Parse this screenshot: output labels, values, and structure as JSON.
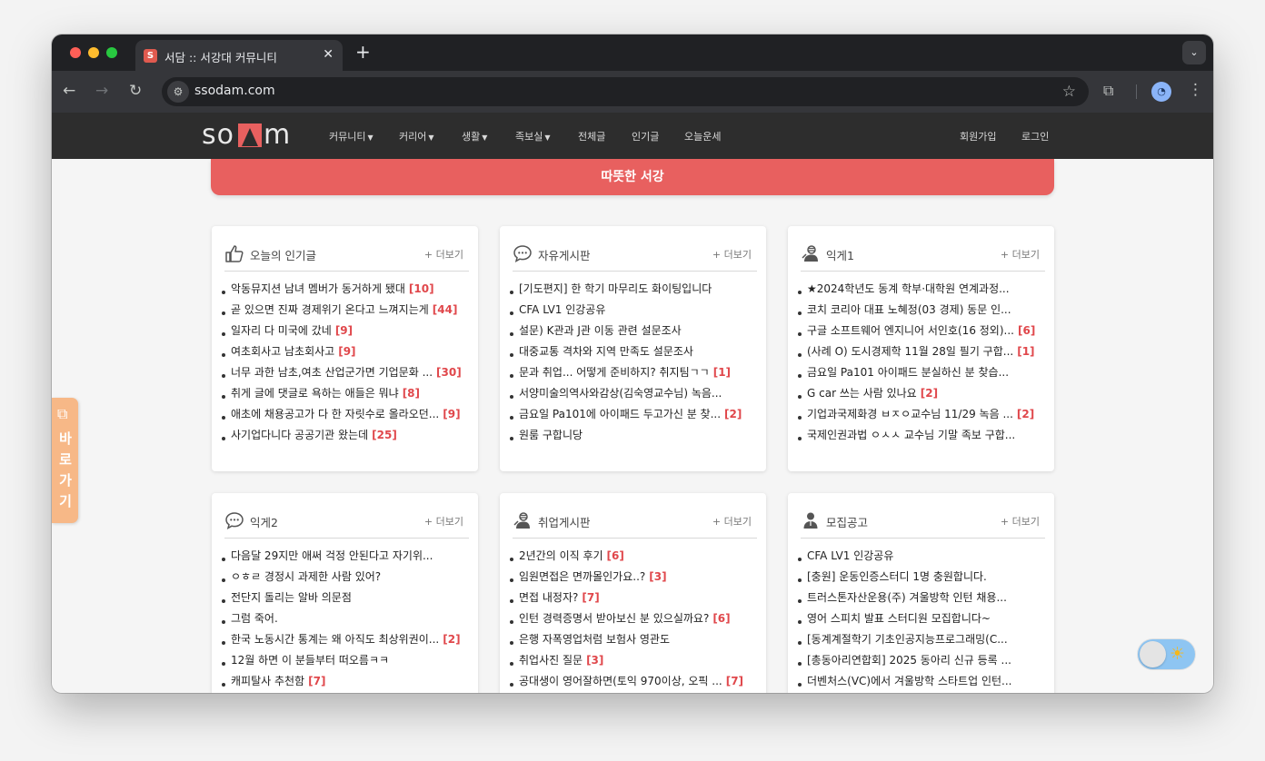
{
  "browser": {
    "tab_title": "서담 :: 서강대 커뮤니티",
    "favicon_letter": "S",
    "url": "ssodam.com"
  },
  "site": {
    "logo_text": "sodam",
    "menu": [
      {
        "label": "커뮤니티",
        "dropdown": true
      },
      {
        "label": "커리어",
        "dropdown": true
      },
      {
        "label": "생활",
        "dropdown": true
      },
      {
        "label": "족보실",
        "dropdown": true
      },
      {
        "label": "전체글",
        "dropdown": false
      },
      {
        "label": "인기글",
        "dropdown": false
      },
      {
        "label": "오늘운세",
        "dropdown": false
      }
    ],
    "signup": "회원가입",
    "login": "로그인"
  },
  "banner": "따뜻한 서강",
  "more_label": "+ 더보기",
  "sidetab_label": "바로가기",
  "colors": {
    "accent": "#e8605f",
    "count": "#e0474b",
    "header_bg": "#2d2d2d",
    "sidetab": "#f7b887",
    "toggle": "#8ec5f2"
  },
  "boards": [
    {
      "title": "오늘의 인기글",
      "icon": "thumbs-up-icon",
      "posts": [
        {
          "title": "악동뮤지션 남녀 멤버가 동거하게 됐대",
          "count": "[10]"
        },
        {
          "title": "곧 있으면 진짜 경제위기 온다고 느껴지는게",
          "count": "[44]"
        },
        {
          "title": "일자리 다 미국에 갔네",
          "count": "[9]"
        },
        {
          "title": "여초회사고 남초회사고",
          "count": "[9]"
        },
        {
          "title": "너무 과한 남초,여초 산업군가면 기업문화 ...",
          "count": "[30]"
        },
        {
          "title": "취게 글에 댓글로 욕하는 애들은 뭐냐",
          "count": "[8]"
        },
        {
          "title": "애초에 채용공고가 다 한 자릿수로 올라오던...",
          "count": "[9]"
        },
        {
          "title": "사기업다니다 공공기관 왔는데",
          "count": "[25]"
        }
      ]
    },
    {
      "title": "자유게시판",
      "icon": "chat-bubble-icon",
      "posts": [
        {
          "title": "[기도편지] 한 학기 마무리도 화이팅입니다",
          "count": ""
        },
        {
          "title": "CFA LV1 인강공유",
          "count": ""
        },
        {
          "title": "설문) K관과 J관 이동 관련 설문조사",
          "count": ""
        },
        {
          "title": "대중교통 격차와 지역 만족도 설문조사",
          "count": ""
        },
        {
          "title": "문과 취업... 어떻게 준비하지? 취지팀ㄱㄱ",
          "count": "[1]"
        },
        {
          "title": "서양미술의역사와감상(김숙영교수님) 녹음...",
          "count": ""
        },
        {
          "title": "금요일 Pa101에 아이패드 두고가신 분 찾...",
          "count": "[2]"
        },
        {
          "title": "원룸 구합니당",
          "count": ""
        }
      ]
    },
    {
      "title": "익게1",
      "icon": "anonymous-user-icon",
      "posts": [
        {
          "title": "★2024학년도 동계 학부·대학원 연계과정...",
          "count": ""
        },
        {
          "title": "코치 코리아 대표 노혜정(03 경제) 동문 인...",
          "count": ""
        },
        {
          "title": "구글 소프트웨어 엔지니어 서인호(16 정외)...",
          "count": "[6]"
        },
        {
          "title": "(사례 O) 도시경제학 11월 28일 필기 구합...",
          "count": "[1]"
        },
        {
          "title": "금요일 Pa101 아이패드 분실하신 분 찾습...",
          "count": ""
        },
        {
          "title": "G car 쓰는 사람 있나요",
          "count": "[2]"
        },
        {
          "title": "기업과국제화경 ㅂㅈㅇ교수님 11/29 녹음 ...",
          "count": "[2]"
        },
        {
          "title": "국제인권과법 ㅇㅅㅅ 교수님 기말 족보 구합...",
          "count": ""
        }
      ]
    },
    {
      "title": "익게2",
      "icon": "chat-bubble-icon",
      "posts": [
        {
          "title": "다음달 29지만 애써 걱정 안된다고 자기위...",
          "count": ""
        },
        {
          "title": "ㅇㅎㄹ 경정시 과제한 사람 있어?",
          "count": ""
        },
        {
          "title": "전단지 돌리는 알바 의문점",
          "count": ""
        },
        {
          "title": "그럼 죽어.",
          "count": ""
        },
        {
          "title": "한국 노동시간 통계는 왜 아직도 최상위권이...",
          "count": "[2]"
        },
        {
          "title": "12월 하면 이 분들부터 떠오름ㅋㅋ",
          "count": ""
        },
        {
          "title": "캐피탈사 추천함",
          "count": "[7]"
        }
      ]
    },
    {
      "title": "취업게시판",
      "icon": "anonymous-user-icon",
      "posts": [
        {
          "title": "2년간의 이직 후기",
          "count": "[6]"
        },
        {
          "title": "임원면접은 면까몰인가요..?",
          "count": "[3]"
        },
        {
          "title": "면접 내정자?",
          "count": "[7]"
        },
        {
          "title": "인턴 경력증명서 받아보신 분 있으실까요?",
          "count": "[6]"
        },
        {
          "title": "은행 자폭영업처럼 보험사 영관도",
          "count": ""
        },
        {
          "title": "취업사진 질문",
          "count": "[3]"
        },
        {
          "title": "공대생이 영어잘하면(토익 970이상, 오픽 ...",
          "count": "[7]"
        }
      ]
    },
    {
      "title": "모집공고",
      "icon": "person-icon",
      "posts": [
        {
          "title": "CFA LV1 인강공유",
          "count": ""
        },
        {
          "title": "[충원] 운동인증스터디 1명 충원합니다.",
          "count": ""
        },
        {
          "title": "트러스톤자산운용(주) 겨울방학 인턴 채용...",
          "count": ""
        },
        {
          "title": "영어 스피치 발표 스터디원 모집합니다~",
          "count": ""
        },
        {
          "title": "[동계계절학기 기초인공지능프로그래밍(C...",
          "count": ""
        },
        {
          "title": "[총동아리연합회] 2025 동아리 신규 등록 ...",
          "count": ""
        },
        {
          "title": "더벤처스(VC)에서 겨울방학 스타트업 인턴...",
          "count": ""
        }
      ]
    }
  ]
}
